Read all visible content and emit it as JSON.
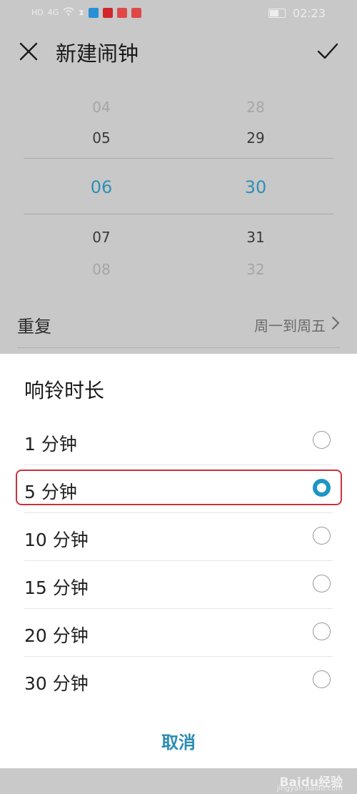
{
  "status_bar": {
    "left_icons": [
      "HD",
      "4G"
    ],
    "time": "02:23"
  },
  "header": {
    "title": "新建闹钟"
  },
  "time_picker": {
    "hours": [
      "04",
      "05",
      "06",
      "07",
      "08"
    ],
    "minutes": [
      "28",
      "29",
      "30",
      "31",
      "32"
    ],
    "selected_hour": "06",
    "selected_minute": "30"
  },
  "repeat": {
    "label": "重复",
    "value": "周一到周五"
  },
  "sheet": {
    "title": "响铃时长",
    "options": [
      {
        "label": "1 分钟",
        "selected": false
      },
      {
        "label": "5 分钟",
        "selected": true
      },
      {
        "label": "10 分钟",
        "selected": false
      },
      {
        "label": "15 分钟",
        "selected": false
      },
      {
        "label": "20 分钟",
        "selected": false
      },
      {
        "label": "30 分钟",
        "selected": false
      }
    ],
    "cancel_label": "取消"
  },
  "watermark": {
    "text": "Baidu经验",
    "sub": "jingyan.baidu.com"
  },
  "colors": {
    "accent": "#1e95c4",
    "highlight_border": "#c8323c"
  }
}
